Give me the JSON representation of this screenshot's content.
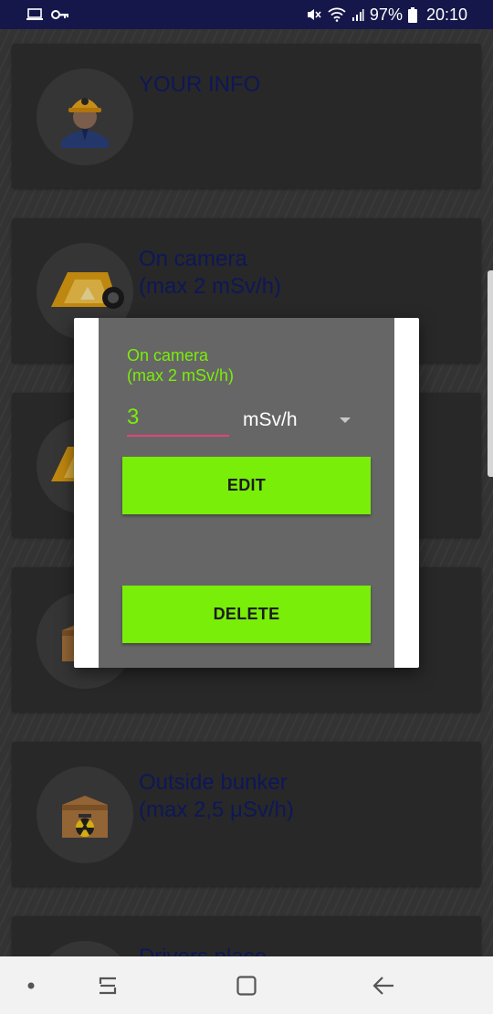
{
  "status_bar": {
    "battery": "97%",
    "time": "20:10",
    "icons": [
      "laptop-icon",
      "key-icon",
      "mute-icon",
      "wifi-icon",
      "signal-icon",
      "battery-icon"
    ]
  },
  "cards": [
    {
      "title": "YOUR INFO",
      "icon": "worker-icon"
    },
    {
      "title": "On camera\n(max 2 mSv/h)",
      "icon": "camera-icon"
    },
    {
      "title": "",
      "icon": "camera-icon"
    },
    {
      "title": "",
      "icon": "box-icon"
    },
    {
      "title": "Outside bunker\n(max 2,5 μSv/h)",
      "icon": "radioactive-box-icon"
    },
    {
      "title": "Drivers place",
      "icon": "driver-icon"
    }
  ],
  "dialog": {
    "title": "On camera\n(max 2 mSv/h)",
    "value": "3",
    "unit": "mSv/h",
    "edit_label": "EDIT",
    "delete_label": "DELETE"
  },
  "colors": {
    "accent": "#79ee09",
    "input_underline": "#e8417a",
    "card_title": "#111b63",
    "status_bar": "#15174a"
  },
  "nav": {
    "icons": [
      "dot-icon",
      "recents-icon",
      "home-icon",
      "back-icon"
    ]
  }
}
